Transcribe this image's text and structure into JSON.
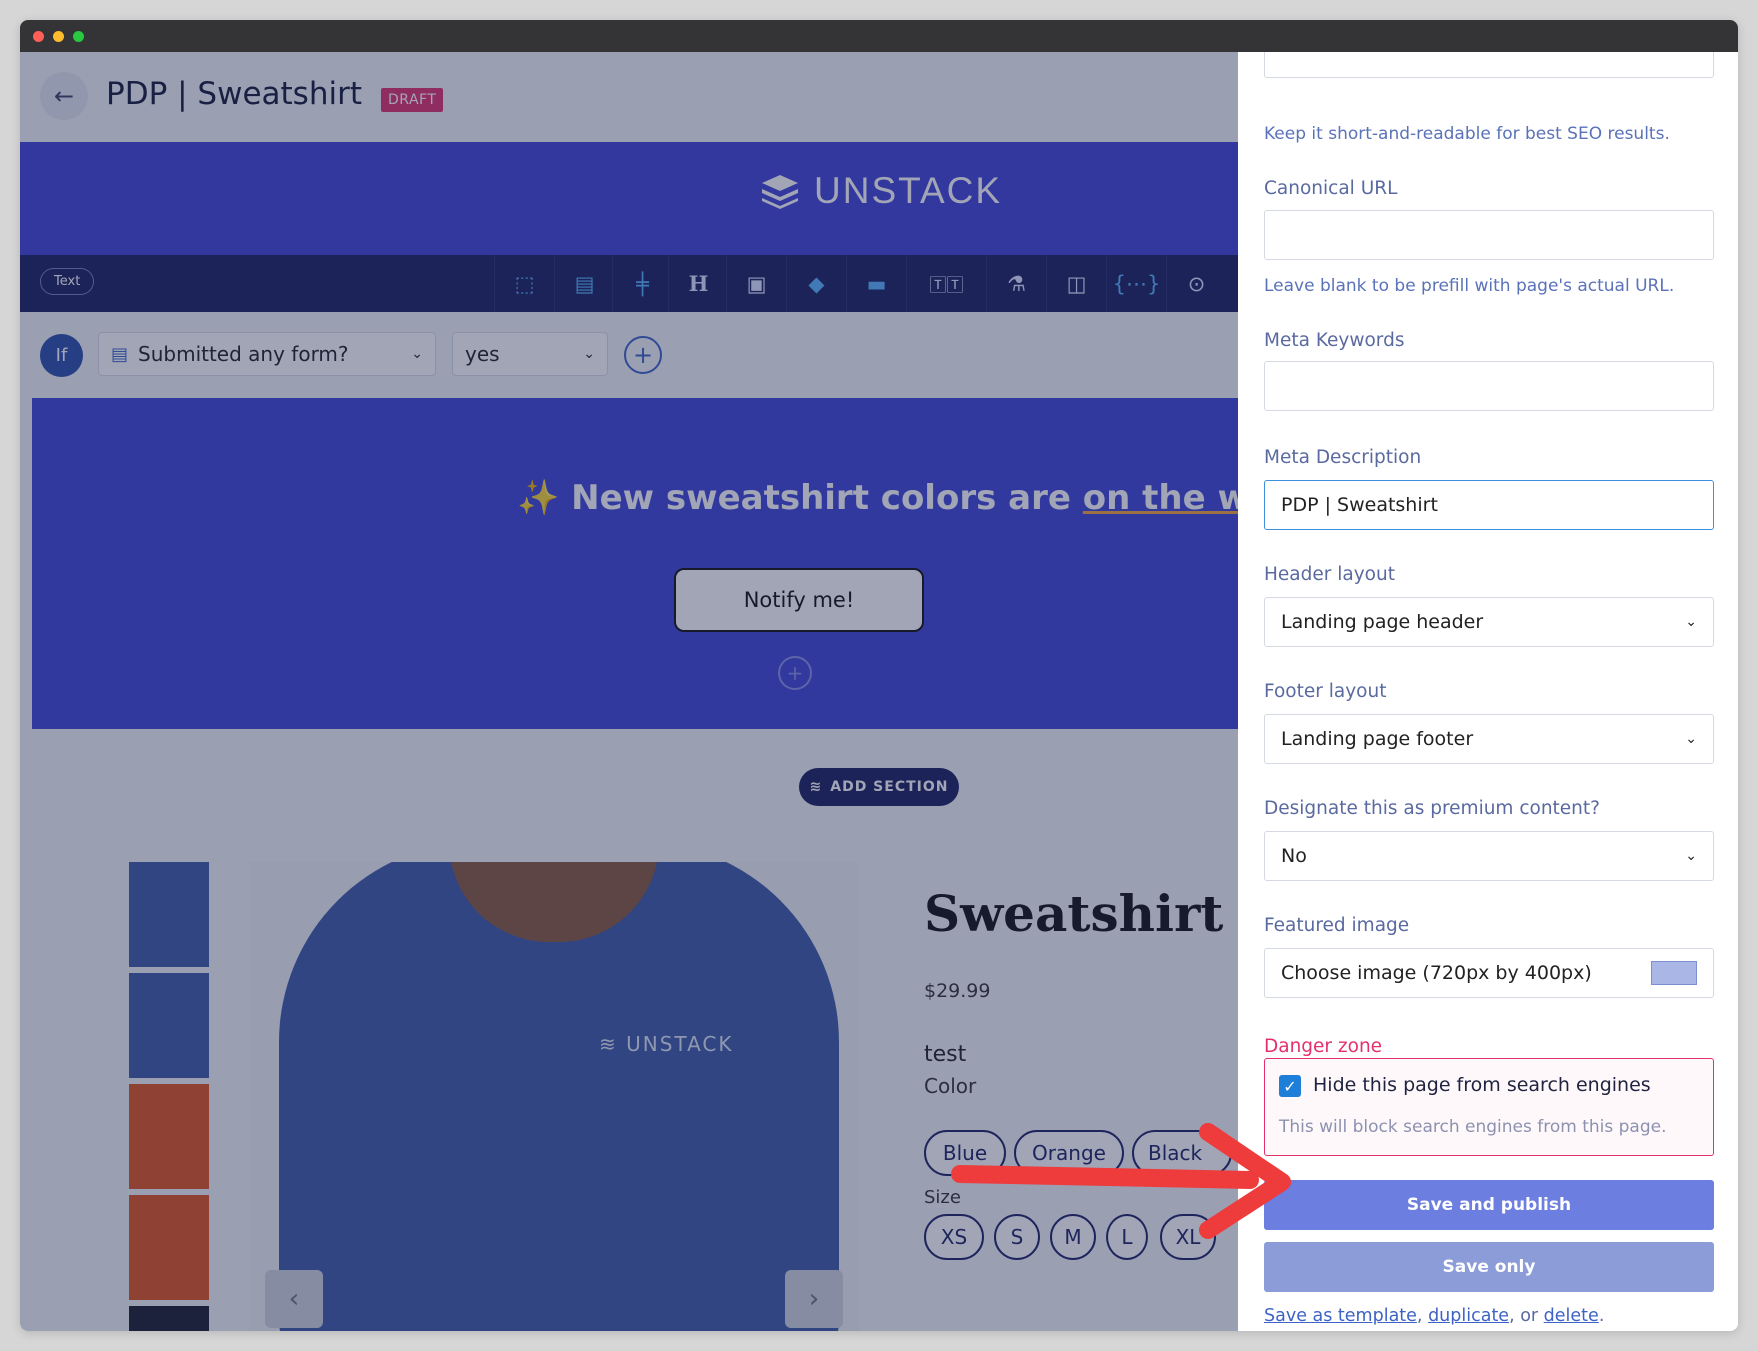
{
  "topbar": {
    "title": "PDP | Sweatshirt",
    "status_badge": "DRAFT"
  },
  "site_header": {
    "logo_text": "UNSTACK"
  },
  "toolbar": {
    "element_pill": "Text"
  },
  "condition": {
    "if_label": "If",
    "condition_select": "Submitted any form?",
    "value_select": "yes"
  },
  "promo": {
    "text_prefix": "✨ New sweatshirt colors are ",
    "text_link": "on the way",
    "text_suffix": " ✨",
    "button_label": "Notify me!"
  },
  "add_section": {
    "label": "ADD SECTION"
  },
  "product": {
    "title": "Sweatshirt",
    "price": "$29.99",
    "description": "test",
    "color_label": "Color",
    "colors": [
      "Blue",
      "Orange",
      "Black"
    ],
    "size_label": "Size",
    "sizes": [
      "XS",
      "S",
      "M",
      "L",
      "XL"
    ],
    "shirt_logo": "UNSTACK",
    "thumbnail_colors": [
      "#3d5aa4",
      "#3d5aa4",
      "#e0541e",
      "#e0541e",
      "#1a1d2e"
    ]
  },
  "settings_panel": {
    "title_hint": "Keep it short-and-readable for best SEO results.",
    "canonical_url_label": "Canonical URL",
    "canonical_url_value": "",
    "canonical_url_hint": "Leave blank to be prefill with page's actual URL.",
    "meta_keywords_label": "Meta Keywords",
    "meta_keywords_value": "",
    "meta_description_label": "Meta Description",
    "meta_description_value": "PDP | Sweatshirt",
    "header_layout_label": "Header layout",
    "header_layout_value": "Landing page header",
    "footer_layout_label": "Footer layout",
    "footer_layout_value": "Landing page footer",
    "premium_label": "Designate this as premium content?",
    "premium_value": "No",
    "featured_image_label": "Featured image",
    "featured_image_value": "Choose image (720px by 400px)",
    "danger_zone_label": "Danger zone",
    "hide_checkbox_label": "Hide this page from search engines",
    "hide_checkbox_checked": true,
    "hide_checkbox_hint": "This will block search engines from this page.",
    "save_publish_label": "Save and publish",
    "save_only_label": "Save only",
    "links_save_template": "Save as template",
    "links_sep1": ", ",
    "links_duplicate": "duplicate",
    "links_sep2": ", or ",
    "links_delete": "delete",
    "links_end": "."
  },
  "colors": {
    "accent": "#4144d4",
    "navy": "#1a1f5e",
    "danger": "#e2316b",
    "primary_button": "#6c7ee0",
    "secondary_button": "#8b9cd8",
    "annotation_arrow": "#ee3b3b"
  }
}
